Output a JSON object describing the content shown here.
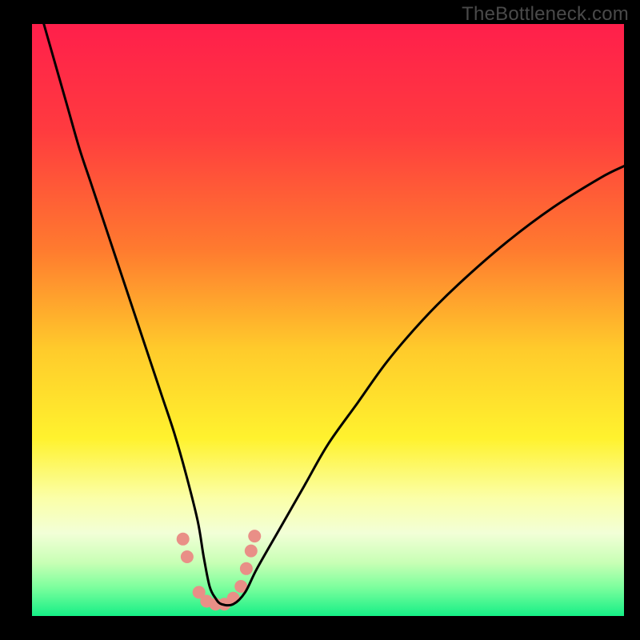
{
  "watermark": "TheBottleneck.com",
  "chart_data": {
    "type": "line",
    "title": "",
    "xlabel": "",
    "ylabel": "",
    "xlim": [
      0,
      100
    ],
    "ylim": [
      0,
      100
    ],
    "background_gradient_stops": [
      {
        "offset": 0,
        "color": "#ff1f4b"
      },
      {
        "offset": 18,
        "color": "#ff3b3f"
      },
      {
        "offset": 38,
        "color": "#ff7a2f"
      },
      {
        "offset": 55,
        "color": "#ffcb2b"
      },
      {
        "offset": 70,
        "color": "#fff22e"
      },
      {
        "offset": 80,
        "color": "#fbffa7"
      },
      {
        "offset": 86,
        "color": "#f2ffd7"
      },
      {
        "offset": 91,
        "color": "#c8ffb5"
      },
      {
        "offset": 95,
        "color": "#7fff9e"
      },
      {
        "offset": 100,
        "color": "#16ef86"
      }
    ],
    "series": [
      {
        "name": "bottleneck-curve",
        "color": "#000000",
        "x": [
          2,
          4,
          6,
          8,
          10,
          12,
          14,
          16,
          18,
          20,
          22,
          24,
          26,
          28,
          29,
          30,
          31,
          32,
          34,
          36,
          38,
          42,
          46,
          50,
          55,
          60,
          66,
          72,
          80,
          88,
          96,
          100
        ],
        "values": [
          100,
          93,
          86,
          79,
          73,
          67,
          61,
          55,
          49,
          43,
          37,
          31,
          24,
          16,
          10,
          5,
          3,
          2,
          2,
          4,
          8,
          15,
          22,
          29,
          36,
          43,
          50,
          56,
          63,
          69,
          74,
          76
        ]
      }
    ],
    "markers": {
      "name": "highlight-dots",
      "color": "#e98f87",
      "radius_px": 8,
      "points": [
        {
          "x": 25.5,
          "y": 13
        },
        {
          "x": 26.2,
          "y": 10
        },
        {
          "x": 28.2,
          "y": 4
        },
        {
          "x": 29.5,
          "y": 2.5
        },
        {
          "x": 31.0,
          "y": 2
        },
        {
          "x": 32.5,
          "y": 2
        },
        {
          "x": 34.0,
          "y": 3
        },
        {
          "x": 35.3,
          "y": 5
        },
        {
          "x": 36.2,
          "y": 8
        },
        {
          "x": 37.0,
          "y": 11
        },
        {
          "x": 37.6,
          "y": 13.5
        }
      ]
    }
  }
}
